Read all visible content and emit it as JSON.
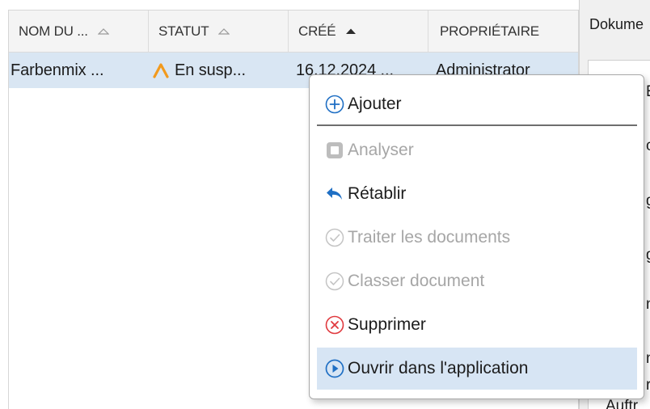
{
  "list": {
    "columns": [
      {
        "label": "NOM DU ...",
        "sort": "none"
      },
      {
        "label": "STATUT",
        "sort": "none"
      },
      {
        "label": "CRÉÉ",
        "sort": "ascending"
      },
      {
        "label": "PROPRIÉTAIRE",
        "sort": "none"
      }
    ],
    "rows": [
      {
        "name": "Farbenmix ...",
        "status": "En susp...",
        "created": "16.12.2024 ...",
        "owner": "Administrator",
        "selected": true
      }
    ]
  },
  "right_panel": {
    "title": "Dokume",
    "fragments": [
      "E",
      "c",
      "g",
      "g",
      "n",
      "n",
      "r",
      "Auftr"
    ]
  },
  "context_menu": {
    "items": [
      {
        "label": "Ajouter",
        "icon": "add-circle-icon",
        "enabled": true,
        "highlighted": false
      },
      {
        "label": "Analyser",
        "icon": "analyze-square-icon",
        "enabled": false,
        "highlighted": false
      },
      {
        "label": "Rétablir",
        "icon": "undo-arrow-icon",
        "enabled": true,
        "highlighted": false
      },
      {
        "label": "Traiter les documents",
        "icon": "check-circle-icon",
        "enabled": false,
        "highlighted": false
      },
      {
        "label": "Classer document",
        "icon": "check-circle-icon",
        "enabled": false,
        "highlighted": false
      },
      {
        "label": "Supprimer",
        "icon": "delete-x-circle-icon",
        "enabled": true,
        "highlighted": false
      },
      {
        "label": "Ouvrir dans l'application",
        "icon": "play-circle-icon",
        "enabled": true,
        "highlighted": true
      }
    ]
  },
  "colors": {
    "selection": "#d9e6f3",
    "menu_highlight": "#d7e5f4",
    "accent_blue": "#1f6fc4",
    "status_orange": "#f29a1d",
    "delete_red": "#e0393e",
    "disabled": "#a6a6a6"
  }
}
